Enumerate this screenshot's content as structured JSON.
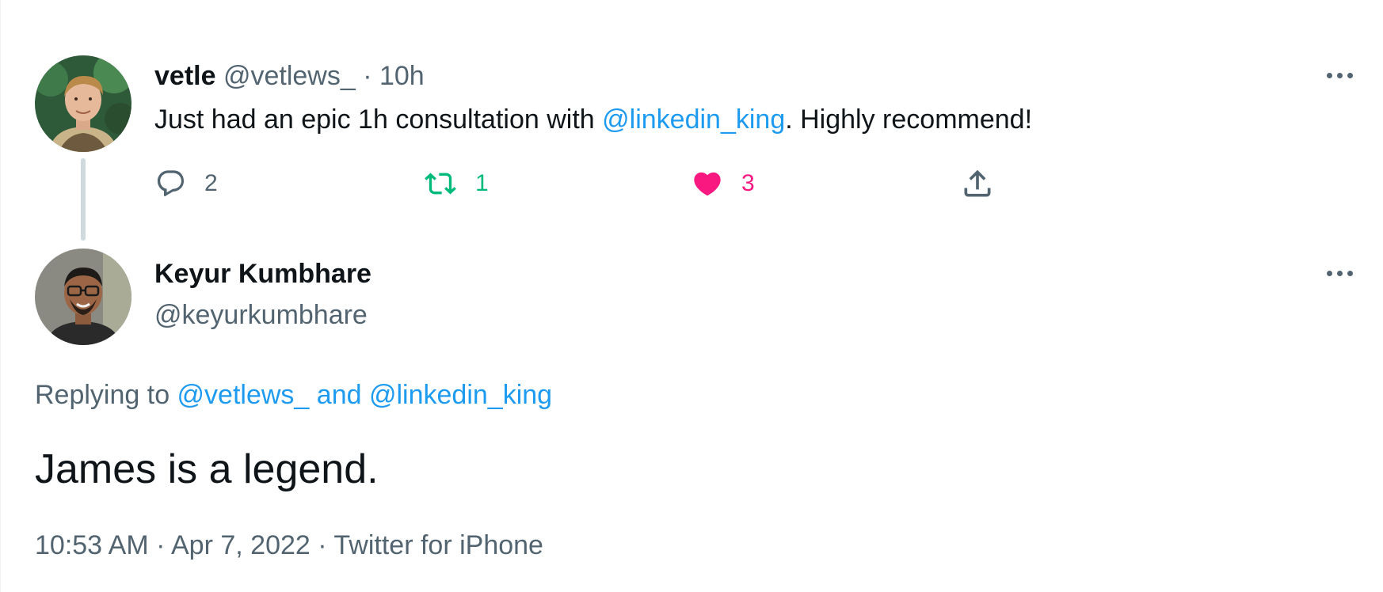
{
  "parent_tweet": {
    "display_name": "vetle",
    "handle": "@vetlews_",
    "separator": "·",
    "time": "10h",
    "text_before": "Just had an epic 1h consultation with ",
    "mention": "@linkedin_king",
    "text_after": ". Highly recommend!",
    "avatar_icon": "avatar-photo-vetle",
    "actions": {
      "reply": {
        "icon": "reply-icon",
        "count": "2"
      },
      "retweet": {
        "icon": "retweet-icon",
        "count": "1",
        "color": "#00ba7c"
      },
      "like": {
        "icon": "heart-filled-icon",
        "count": "3",
        "color": "#f91880"
      },
      "share": {
        "icon": "share-icon"
      }
    },
    "more_icon": "more-horizontal-icon"
  },
  "reply_tweet": {
    "display_name": "Keyur Kumbhare",
    "handle": "@keyurkumbhare",
    "avatar_icon": "avatar-photo-keyur",
    "replying_prefix": "Replying to ",
    "replying_mention_1": "@vetlews_",
    "replying_and": " and ",
    "replying_mention_2": "@linkedin_king",
    "text": "James is a legend.",
    "time": "10:53 AM",
    "date": "Apr 7, 2022",
    "source": "Twitter for iPhone",
    "meta_separator": " · ",
    "more_icon": "more-horizontal-icon"
  },
  "colors": {
    "text": "#0f1419",
    "muted": "#536471",
    "link": "#1d9bf0",
    "thread_line": "#cfd9de"
  }
}
